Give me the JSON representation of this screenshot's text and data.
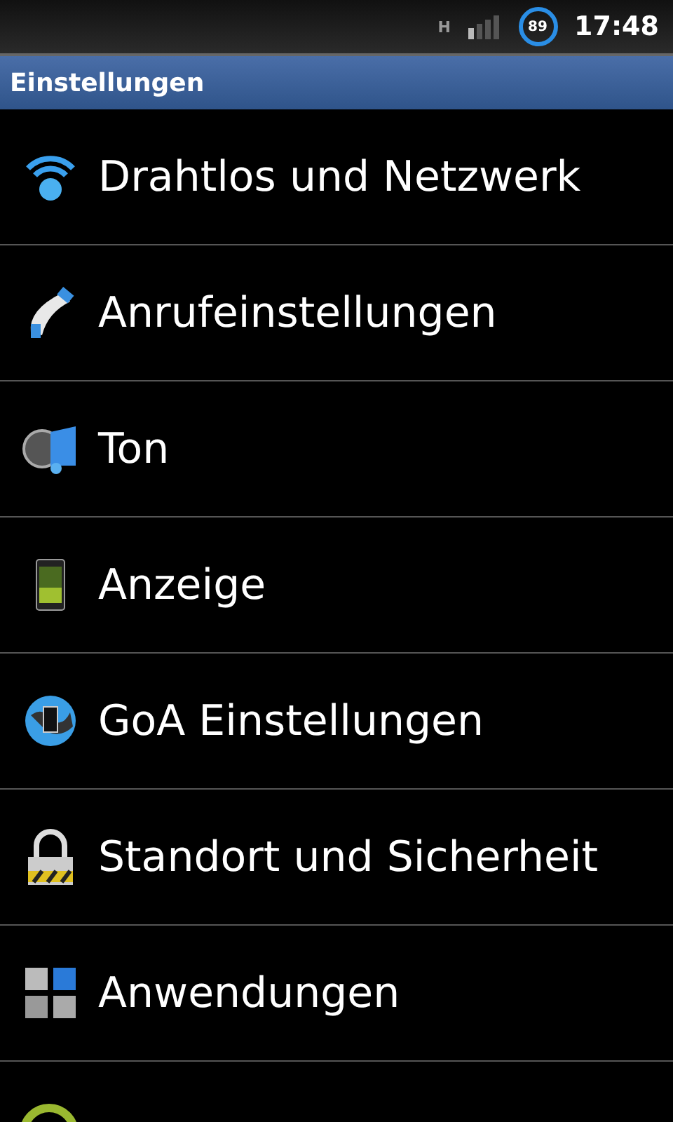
{
  "status_bar": {
    "network": "H",
    "battery": "89",
    "time": "17:48"
  },
  "title": "Einstellungen",
  "items": [
    {
      "label": "Drahtlos und Netzwerk"
    },
    {
      "label": "Anrufeinstellungen"
    },
    {
      "label": "Ton"
    },
    {
      "label": "Anzeige"
    },
    {
      "label": "GoA Einstellungen"
    },
    {
      "label": "Standort und Sicherheit"
    },
    {
      "label": "Anwendungen"
    }
  ]
}
